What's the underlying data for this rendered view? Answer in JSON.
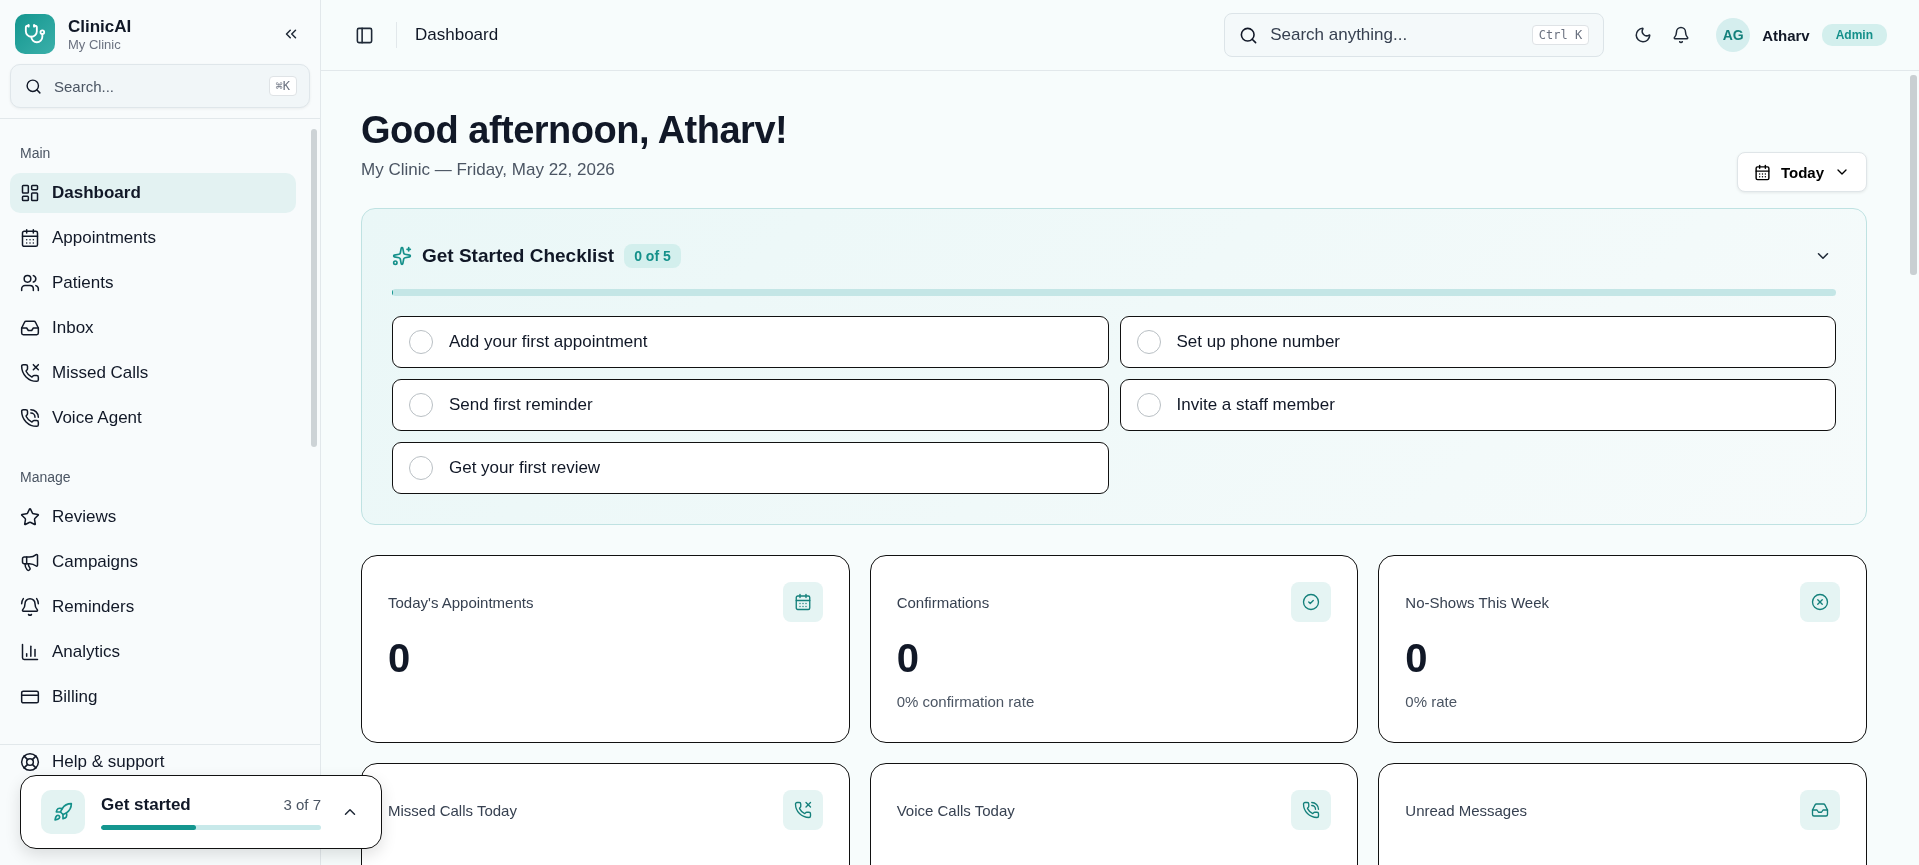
{
  "sidebar": {
    "brand": {
      "name": "ClinicAI",
      "subtitle": "My Clinic"
    },
    "search": {
      "placeholder": "Search...",
      "shortcut": "⌘K"
    },
    "sections": [
      {
        "title": "Main",
        "items": [
          {
            "label": "Dashboard",
            "selected": true
          },
          {
            "label": "Appointments",
            "selected": false
          },
          {
            "label": "Patients",
            "selected": false
          },
          {
            "label": "Inbox",
            "selected": false
          },
          {
            "label": "Missed Calls",
            "selected": false
          },
          {
            "label": "Voice Agent",
            "selected": false
          }
        ]
      },
      {
        "title": "Manage",
        "items": [
          {
            "label": "Reviews",
            "selected": false
          },
          {
            "label": "Campaigns",
            "selected": false
          },
          {
            "label": "Reminders",
            "selected": false
          },
          {
            "label": "Analytics",
            "selected": false
          },
          {
            "label": "Billing",
            "selected": false
          }
        ]
      }
    ],
    "footer_items": [
      {
        "label": "Help & support"
      }
    ]
  },
  "header": {
    "page_title": "Dashboard",
    "search": {
      "placeholder": "Search anything...",
      "shortcut": "Ctrl K"
    },
    "user": {
      "initials": "AG",
      "name": "Atharv",
      "role": "Admin"
    }
  },
  "greeting": {
    "title": "Good afternoon, Atharv!",
    "subtitle": "My Clinic — Friday, May 22, 2026"
  },
  "date_filter": {
    "label": "Today"
  },
  "checklist": {
    "title": "Get Started Checklist",
    "count": "0 of 5",
    "level": 0,
    "items": [
      {
        "label": "Add your first appointment",
        "checked": false
      },
      {
        "label": "Set up phone number",
        "checked": false
      },
      {
        "label": "Send first reminder",
        "checked": false
      },
      {
        "label": "Invite a staff member",
        "checked": false
      },
      {
        "label": "Get your first review",
        "checked": false
      }
    ]
  },
  "stats": [
    {
      "title": "Today's Appointments",
      "value": "0"
    },
    {
      "title": "Confirmations",
      "value": "0",
      "note": "0% confirmation rate"
    },
    {
      "title": "No-Shows This Week",
      "value": "0",
      "note": "0% rate"
    },
    {
      "title": "Missed Calls Today"
    },
    {
      "title": "Voice Calls Today"
    },
    {
      "title": "Unread Messages"
    }
  ],
  "get_started_popup": {
    "title": "Get started",
    "count": "3 of 7",
    "level": 0.43
  }
}
